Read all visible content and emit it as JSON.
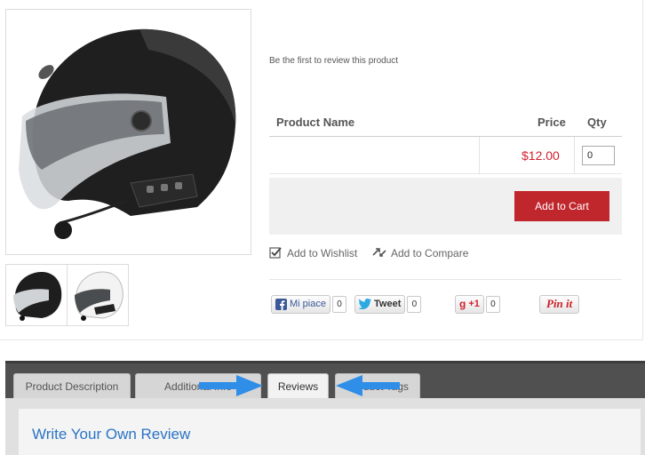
{
  "product": {
    "review_prompt": "Be the first to review this product",
    "table": {
      "headers": {
        "name": "Product Name",
        "price": "Price",
        "qty": "Qty"
      },
      "row": {
        "price": "$12.00",
        "qty": "0"
      }
    },
    "add_to_cart_label": "Add to Cart",
    "wishlist_label": "Add to Wishlist",
    "compare_label": "Add to Compare"
  },
  "social": {
    "facebook": {
      "label": "Mi piace",
      "count": "0"
    },
    "twitter": {
      "label": "Tweet",
      "count": "0"
    },
    "gplus": {
      "label": "+1",
      "count": "0"
    },
    "pinterest": {
      "label": "Pin it"
    }
  },
  "tabs": [
    {
      "label": "Product Description"
    },
    {
      "label": "Additional Info"
    },
    {
      "label": "Reviews"
    },
    {
      "label": "Product Tags"
    }
  ],
  "reviews": {
    "title": "Write Your Own Review"
  },
  "colors": {
    "accent_red": "#c0272d",
    "price_red": "#d0202e",
    "link_blue": "#2b74c4",
    "annotation_arrow": "#2f8ee8"
  },
  "icons": [
    "helmet-image",
    "checkbox-icon",
    "compare-arrows-icon",
    "facebook-icon",
    "twitter-icon",
    "gplus-icon",
    "pinterest-icon",
    "arrow-right-annotation",
    "arrow-left-annotation"
  ]
}
